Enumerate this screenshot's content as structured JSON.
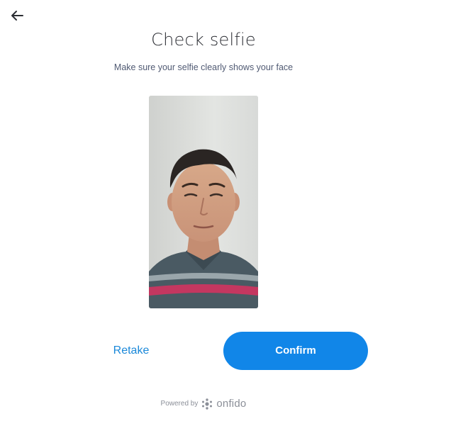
{
  "header": {
    "back_icon": "arrow-left-icon",
    "title": "Check selfie",
    "subtitle": "Make sure your selfie clearly shows your face"
  },
  "selfie": {
    "image": "selfie-photo"
  },
  "actions": {
    "retake_label": "Retake",
    "confirm_label": "Confirm"
  },
  "footer": {
    "powered_by": "Powered by",
    "brand": "onfido",
    "brand_icon": "onfido-logo-icon"
  },
  "colors": {
    "accent": "#1186e8",
    "link": "#1a88d9",
    "title": "#2b2d33",
    "muted": "#8b8f98"
  }
}
